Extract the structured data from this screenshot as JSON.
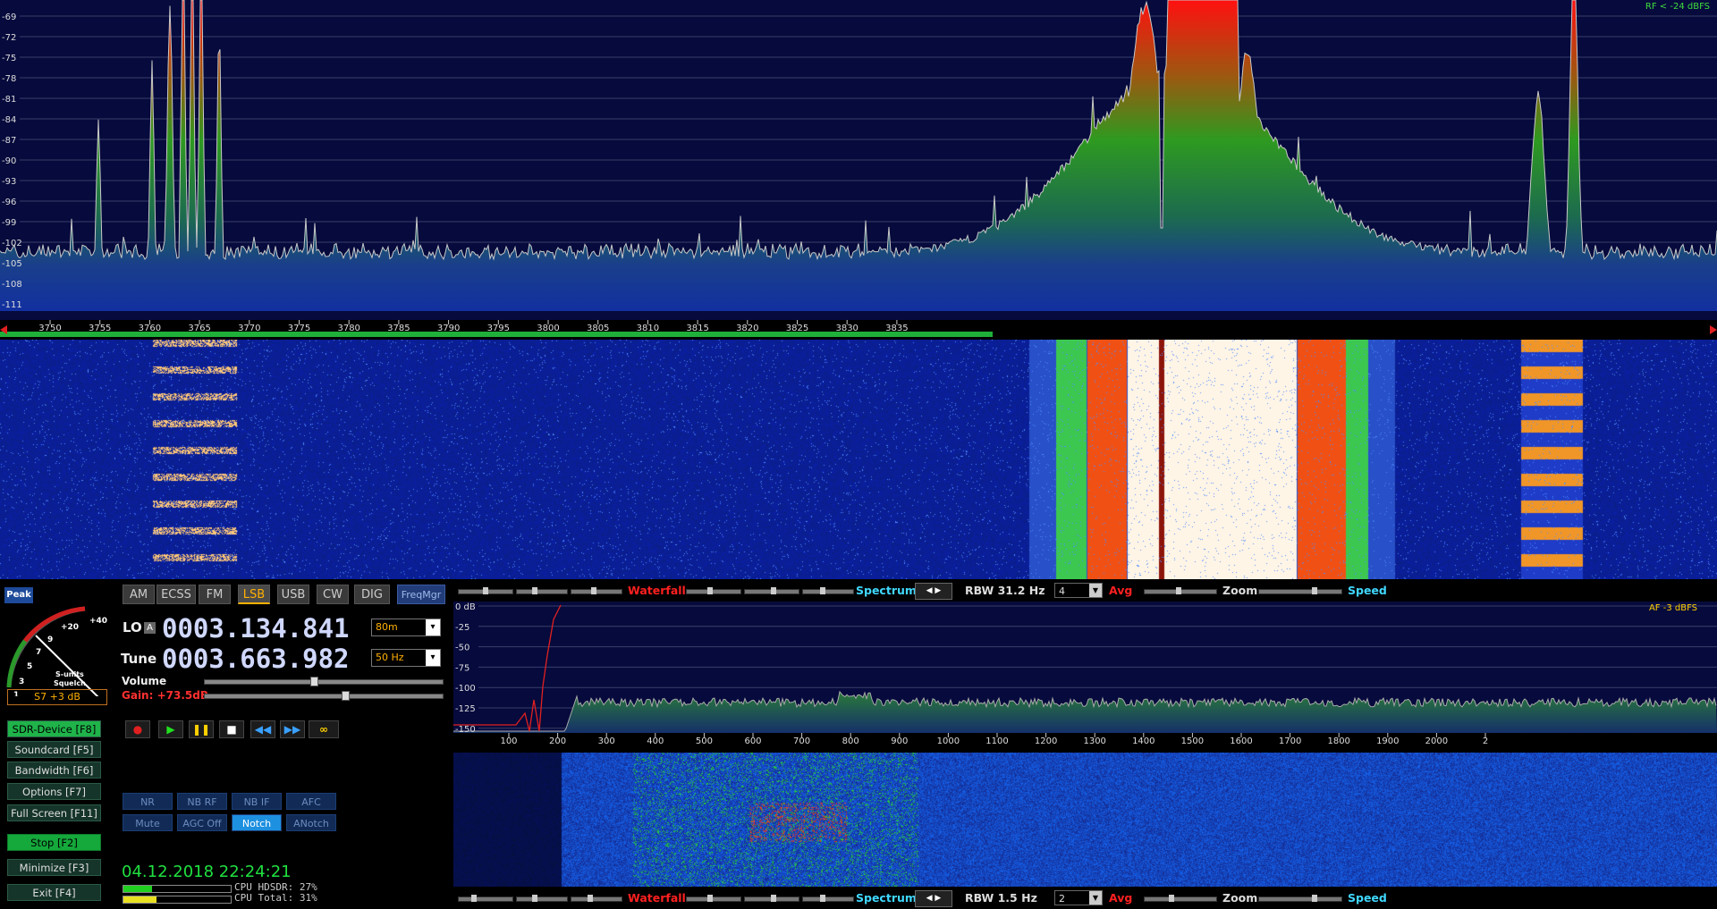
{
  "rf": {
    "level_indicator": "RF < -24 dBFS",
    "y_ticks": [
      "-69",
      "-72",
      "-75",
      "-78",
      "-81",
      "-84",
      "-87",
      "-90",
      "-93",
      "-96",
      "-99",
      "-102",
      "-105",
      "-108",
      "-111"
    ],
    "x_ticks": [
      "3750",
      "3755",
      "3760",
      "3765",
      "3770",
      "3775",
      "3780",
      "3785",
      "3790",
      "3795",
      "3800",
      "3805",
      "3810",
      "3815",
      "3820",
      "3825",
      "3830",
      "3835"
    ]
  },
  "controls": {
    "peak_label": "Peak",
    "smeter": {
      "ticks": [
        "+40",
        "+20",
        "9",
        "7",
        "5",
        "3",
        "1"
      ],
      "caption_top": "S-units",
      "caption_bottom": "Squelch",
      "reading": "S7 +3 dB"
    },
    "modes": [
      "AM",
      "ECSS",
      "FM",
      "LSB",
      "USB",
      "CW",
      "DIG"
    ],
    "active_mode": "LSB",
    "freqmgr": "FreqMgr",
    "lo": {
      "label": "LO",
      "a_badge": "A",
      "value": "0003.134.841",
      "band": "80m"
    },
    "tune": {
      "label": "Tune",
      "value": "0003.663.982",
      "step": "50 Hz"
    },
    "volume_label": "Volume",
    "gain_label": "Gain: +73.5dB",
    "side_buttons": [
      "SDR-Device [F8]",
      "Soundcard [F5]",
      "Bandwidth [F6]",
      "Options [F7]",
      "Full Screen [F11]",
      "Stop [F2]",
      "Minimize [F3]",
      "Exit [F4]"
    ],
    "dsp_row1": [
      "NR",
      "NB RF",
      "NB IF",
      "AFC"
    ],
    "dsp_row2": [
      "Mute",
      "AGC Off",
      "Notch",
      "ANotch"
    ],
    "datetime": "04.12.2018 22:24:21",
    "cpu_hdsdr": "CPU HDSDR: 27%",
    "cpu_total": "CPU Total: 31%",
    "colors": {
      "accent": "#ffb000",
      "green_btn": "#15a83b",
      "notch_on": "#1e90e0"
    }
  },
  "rf_bar": {
    "waterfall": "Waterfall",
    "spectrum": "Spectrum",
    "rbw": "RBW 31.2 Hz",
    "avg_value": "4",
    "avg": "Avg",
    "zoom": "Zoom",
    "speed": "Speed"
  },
  "af": {
    "level_indicator": "AF -3 dBFS",
    "y_ticks": [
      "0 dB",
      "-25",
      "-50",
      "-75",
      "-100",
      "-125",
      "-150"
    ],
    "x_ticks": [
      "100",
      "200",
      "300",
      "400",
      "500",
      "600",
      "700",
      "800",
      "900",
      "1000",
      "1100",
      "1200",
      "1300",
      "1400",
      "1500",
      "1600",
      "1700",
      "1800",
      "1900",
      "2000",
      "2"
    ]
  },
  "af_bar": {
    "waterfall": "Waterfall",
    "spectrum": "Spectrum",
    "rbw": "RBW 1.5 Hz",
    "avg_value": "2",
    "avg": "Avg",
    "zoom": "Zoom",
    "speed": "Speed"
  }
}
